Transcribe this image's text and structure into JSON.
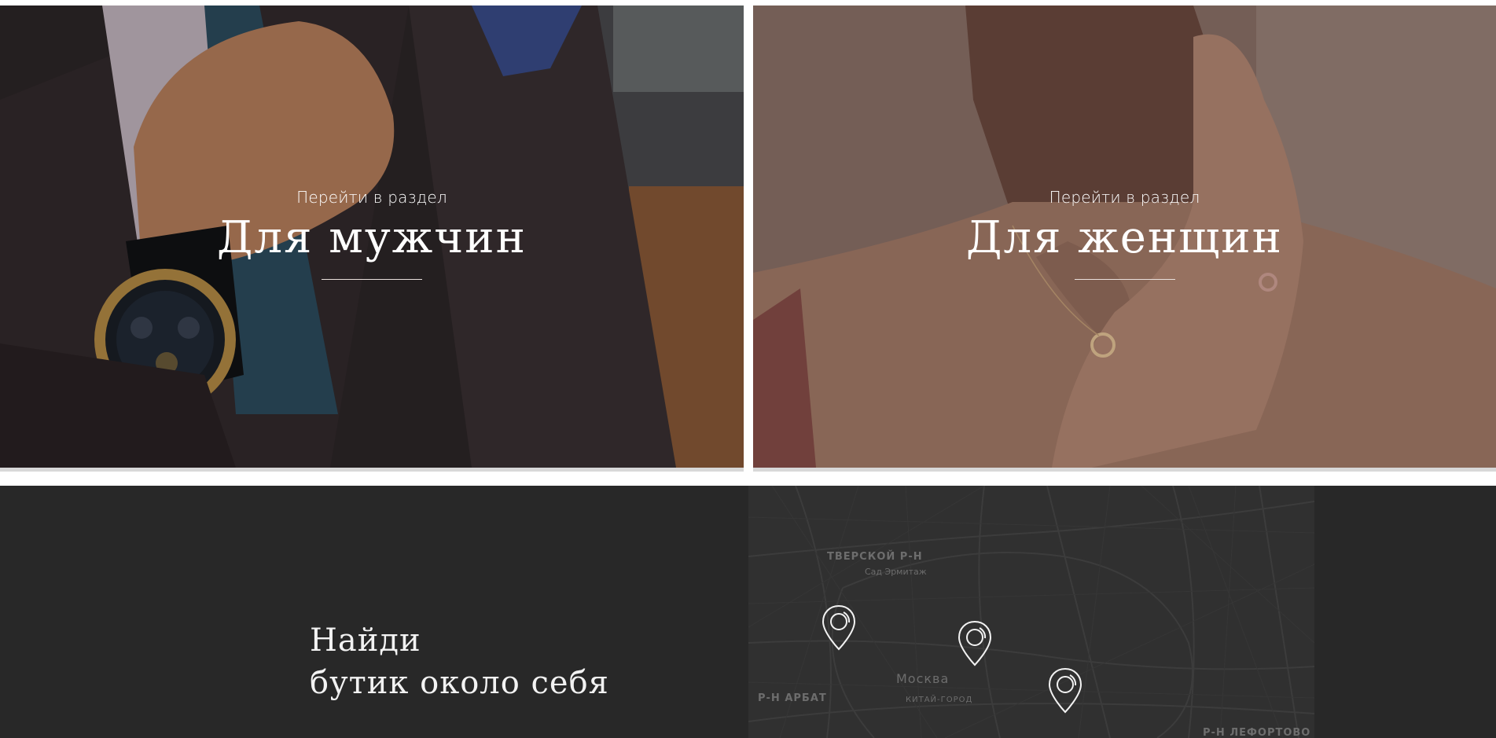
{
  "sections": {
    "men": {
      "subtitle": "Перейти в раздел",
      "title": "Для мужчин"
    },
    "women": {
      "subtitle": "Перейти в раздел",
      "title": "Для женщин"
    }
  },
  "finder": {
    "line1": "Найди",
    "line2": "бутик около себя"
  },
  "map": {
    "labels": {
      "tverskoy": "ТВЕРСКОЙ Р-Н",
      "garden": "Сад Эрмитаж",
      "moscow": "Москва",
      "arbat": "Р-Н АРБАТ",
      "kitay": "КИТАЙ-ГОРОД",
      "lefortovo": "Р-Н ЛЕФОРТОВО"
    },
    "pin_icon": "map-pin-icon"
  },
  "colors": {
    "dark_bg": "#282828",
    "map_bg": "#303030",
    "text_light": "#f2f2f2"
  }
}
